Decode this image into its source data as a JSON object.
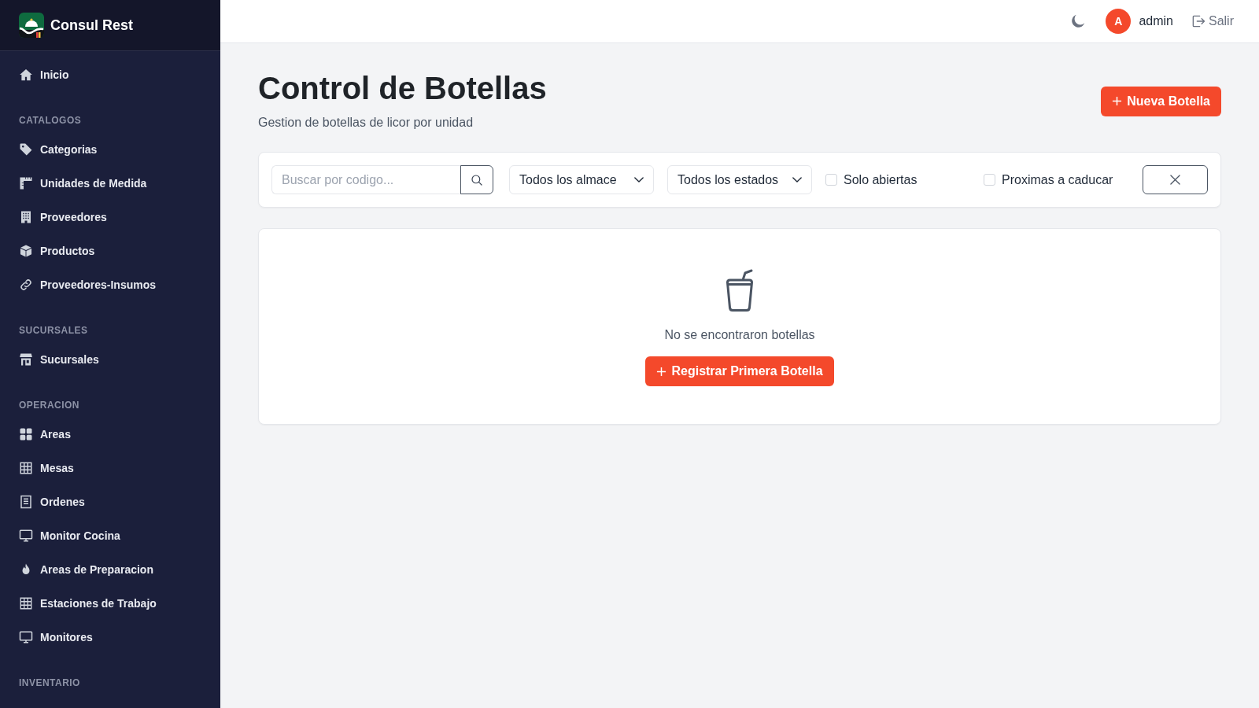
{
  "sidebar": {
    "brand": "Consul Rest",
    "groups": [
      {
        "items": [
          {
            "label": "Inicio",
            "selected": false
          }
        ]
      },
      {
        "heading": "CATALOGOS",
        "items": [
          {
            "label": "Categorias",
            "selected": false
          },
          {
            "label": "Unidades de Medida",
            "selected": false
          },
          {
            "label": "Proveedores",
            "selected": false
          },
          {
            "label": "Productos",
            "selected": false
          },
          {
            "label": "Proveedores-Insumos",
            "selected": false
          }
        ]
      },
      {
        "heading": "SUCURSALES",
        "items": [
          {
            "label": "Sucursales",
            "selected": false
          }
        ]
      },
      {
        "heading": "OPERACION",
        "items": [
          {
            "label": "Areas",
            "selected": false
          },
          {
            "label": "Mesas",
            "selected": false
          },
          {
            "label": "Ordenes",
            "selected": false
          },
          {
            "label": "Monitor Cocina",
            "selected": false
          },
          {
            "label": "Areas de Preparacion",
            "selected": false
          },
          {
            "label": "Estaciones de Trabajo",
            "selected": false
          },
          {
            "label": "Monitores",
            "selected": false
          }
        ]
      },
      {
        "heading": "INVENTARIO"
      }
    ]
  },
  "top_bar": {
    "user": {
      "initial": "A",
      "name": "admin"
    },
    "logout": "Salir"
  },
  "page": {
    "title": "Control de Botellas",
    "subtitle": "Gestion de botellas de licor por unidad",
    "new_button": "Nueva Botella"
  },
  "filters": {
    "search": {
      "placeholder": "Buscar por codigo..."
    },
    "selects": [
      "Todos los almace",
      "Todos los estados"
    ],
    "checkboxes": [
      {
        "label": "Solo abiertas",
        "checked": false
      },
      {
        "label": "Proximas a caducar",
        "checked": false
      }
    ]
  },
  "empty_state": {
    "message": "No se encontraron botellas",
    "button": "Registrar Primera Botella"
  }
}
